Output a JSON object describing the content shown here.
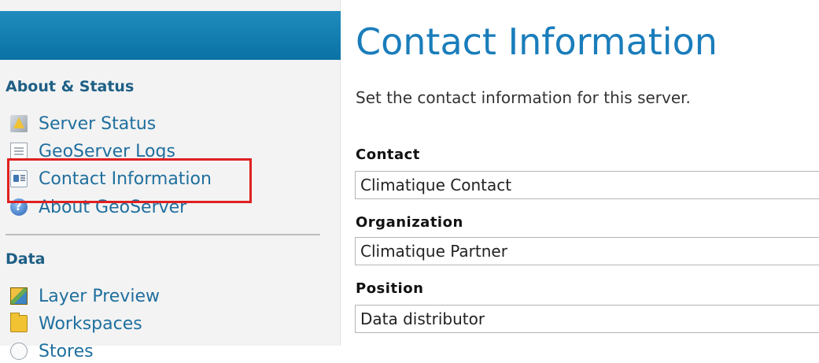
{
  "sidebar": {
    "sections": [
      {
        "heading": "About & Status",
        "items": [
          {
            "label": "Server Status",
            "icon": "server-status-icon"
          },
          {
            "label": "GeoServer Logs",
            "icon": "log-document-icon"
          },
          {
            "label": "Contact Information",
            "icon": "contact-card-icon",
            "highlighted": true
          },
          {
            "label": "About GeoServer",
            "icon": "help-circle-icon"
          }
        ]
      },
      {
        "heading": "Data",
        "items": [
          {
            "label": "Layer Preview",
            "icon": "map-layer-icon"
          },
          {
            "label": "Workspaces",
            "icon": "folder-icon"
          },
          {
            "label": "Stores",
            "icon": "store-icon"
          }
        ]
      }
    ]
  },
  "main": {
    "title": "Contact Information",
    "description": "Set the contact information for this server.",
    "fields": [
      {
        "label": "Contact",
        "value": "Climatique Contact"
      },
      {
        "label": "Organization",
        "value": "Climatique Partner"
      },
      {
        "label": "Position",
        "value": "Data distributor"
      }
    ]
  },
  "colors": {
    "header_blue": "#0a72a4",
    "link_blue": "#1f6f9e",
    "title_blue": "#1a7dbb",
    "highlight_red": "#e02020"
  }
}
